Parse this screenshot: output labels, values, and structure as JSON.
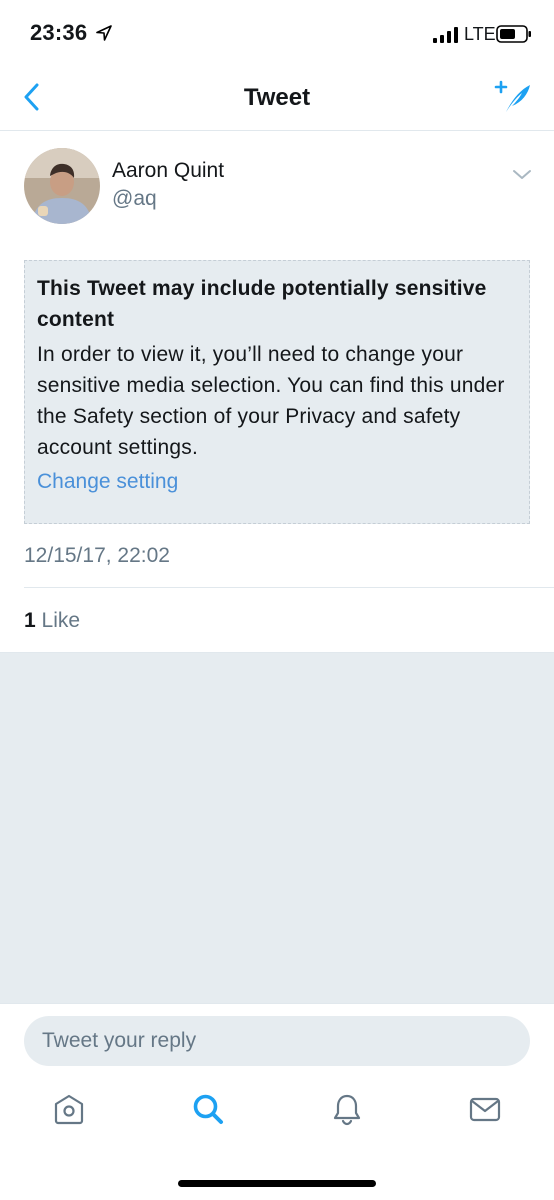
{
  "status_bar": {
    "time": "23:36",
    "network": "LTE"
  },
  "nav": {
    "title": "Tweet"
  },
  "tweet": {
    "author_name": "Aaron Quint",
    "author_handle": "@aq",
    "sensitive_title": "This Tweet may include potentially sensitive content",
    "sensitive_body": "In order to view it, you’ll need to change your sensitive media selection. You can find this under the Safety section of your Privacy and safety account settings.",
    "change_setting_link": "Change setting",
    "timestamp": "12/15/17, 22:02",
    "likes_count": "1",
    "likes_label": " Like"
  },
  "reply": {
    "placeholder": "Tweet your reply"
  },
  "tabs": [
    {
      "icon": "home-icon",
      "active": false
    },
    {
      "icon": "search-icon",
      "active": true
    },
    {
      "icon": "bell-icon",
      "active": false
    },
    {
      "icon": "mail-icon",
      "active": false
    }
  ],
  "colors": {
    "accent": "#1da1f2",
    "link": "#4a90d9",
    "secondary_text": "#657786",
    "panel_bg": "#e6ecf0"
  }
}
